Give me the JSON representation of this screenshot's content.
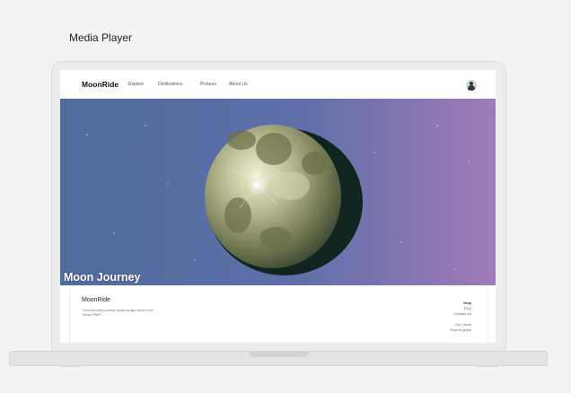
{
  "caption": "Media Player",
  "nav": {
    "brand": "MoonRide",
    "links": [
      "Explore",
      "Destinations",
      "Pictures",
      "About Us"
    ]
  },
  "hero": {
    "title": "Moon Journey"
  },
  "footer": {
    "brand": "MoonRide",
    "tagline": "Your favorite journey booking app since ever. Since PMP!",
    "help_heading": "Help",
    "help_links": [
      "FAQ",
      "Contact Us"
    ],
    "extra_links": [
      "Our Lunar",
      "How to guide"
    ]
  },
  "colors": {
    "background": "#f3f3f3",
    "hero_sky_left": "#4a6ea8",
    "hero_sky_right": "#a07ab8",
    "text_dark": "#111111"
  },
  "icons": {
    "avatar": "user-avatar-icon"
  }
}
